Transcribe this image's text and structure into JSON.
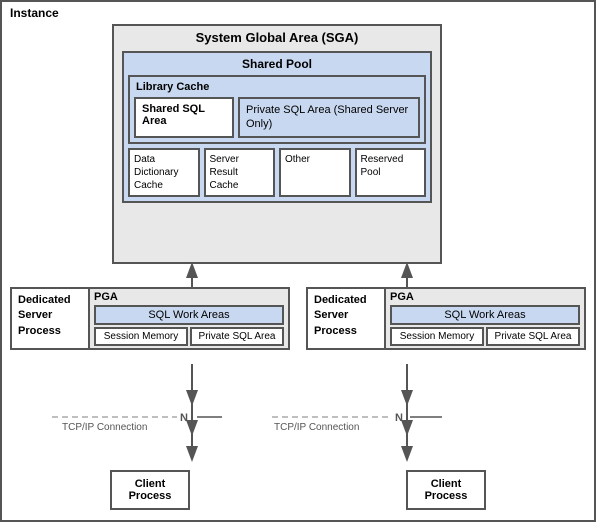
{
  "instance": {
    "label": "Instance"
  },
  "sga": {
    "title": "System Global Area (SGA)",
    "shared_pool": {
      "title": "Shared Pool",
      "library_cache": {
        "title": "Library Cache",
        "shared_sql_area": "Shared SQL Area",
        "private_sql_area": "Private SQL Area (Shared Server Only)"
      },
      "cells": [
        {
          "label": "Data Dictionary Cache"
        },
        {
          "label": "Server Result Cache"
        },
        {
          "label": "Other"
        },
        {
          "label": "Reserved Pool"
        }
      ]
    }
  },
  "server_left": {
    "dedicated_label": "Dedicated Server Process",
    "pga_label": "PGA",
    "sql_work_areas": "SQL Work Areas",
    "session_memory": "Session Memory",
    "private_sql_area": "Private SQL Area"
  },
  "server_right": {
    "dedicated_label": "Dedicated Server Process",
    "pga_label": "PGA",
    "sql_work_areas": "SQL Work Areas",
    "session_memory": "Session Memory",
    "private_sql_area": "Private SQL Area"
  },
  "client_left": {
    "label": "Client Process",
    "tcp_label": "TCP/IP Connection",
    "n_label": "N"
  },
  "client_right": {
    "label": "Client Process",
    "tcp_label": "TCP/IP Connection",
    "n_label": "N"
  }
}
